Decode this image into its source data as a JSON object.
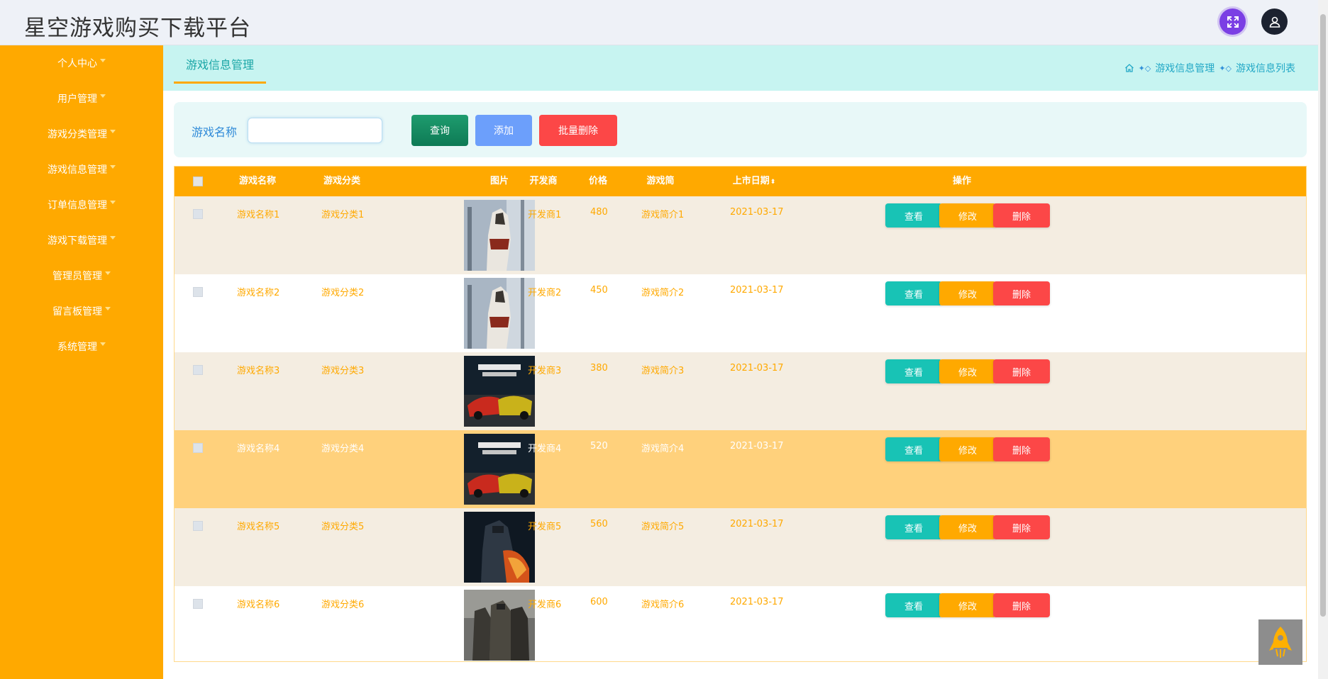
{
  "header": {
    "title": "星空游戏购买下载平台",
    "fullscreen_icon": "expand-icon",
    "user_icon": "user-icon"
  },
  "sidebar": {
    "items": [
      {
        "label": "个人中心"
      },
      {
        "label": "用户管理"
      },
      {
        "label": "游戏分类管理"
      },
      {
        "label": "游戏信息管理"
      },
      {
        "label": "订单信息管理"
      },
      {
        "label": "游戏下载管理"
      },
      {
        "label": "管理员管理"
      },
      {
        "label": "留言板管理"
      },
      {
        "label": "系统管理"
      }
    ]
  },
  "tabs": {
    "active": "游戏信息管理"
  },
  "breadcrumb": {
    "items": [
      "游戏信息管理",
      "游戏信息列表"
    ]
  },
  "search": {
    "label": "游戏名称",
    "value": "",
    "placeholder": "",
    "query_label": "查询",
    "add_label": "添加",
    "batch_delete_label": "批量删除"
  },
  "table": {
    "columns": {
      "name": "游戏名称",
      "category": "游戏分类",
      "image": "图片",
      "developer": "开发商",
      "price": "价格",
      "intro": "游戏简介",
      "release_date": "上市日期",
      "actions": "操作"
    },
    "rows": [
      {
        "name": "游戏名称1",
        "category": "游戏分类1",
        "developer": "开发商1",
        "price": "480",
        "intro": "游戏简介1",
        "release_date": "2021-03-17",
        "image": "hooded-warrior-snow"
      },
      {
        "name": "游戏名称2",
        "category": "游戏分类2",
        "developer": "开发商2",
        "price": "450",
        "intro": "游戏简介2",
        "release_date": "2021-03-17",
        "image": "hooded-warrior-snow"
      },
      {
        "name": "游戏名称3",
        "category": "游戏分类3",
        "developer": "开发商3",
        "price": "380",
        "intro": "游戏简介3",
        "release_date": "2021-03-17",
        "image": "racing-cars-night"
      },
      {
        "name": "游戏名称4",
        "category": "游戏分类4",
        "developer": "开发商4",
        "price": "520",
        "intro": "游戏简介4",
        "release_date": "2021-03-17",
        "image": "racing-cars-night"
      },
      {
        "name": "游戏名称5",
        "category": "游戏分类5",
        "developer": "开发商5",
        "price": "560",
        "intro": "游戏简介5",
        "release_date": "2021-03-17",
        "image": "soldier-fire"
      },
      {
        "name": "游戏名称6",
        "category": "游戏分类6",
        "developer": "开发商6",
        "price": "600",
        "intro": "游戏简介6",
        "release_date": "2021-03-17",
        "image": "squad-soldiers"
      }
    ],
    "action_labels": {
      "view": "查看",
      "edit": "修改",
      "delete": "删除"
    }
  },
  "colors": {
    "accent": "#ffa900",
    "teal": "#18c3b5",
    "danger": "#fc4747",
    "primary_blue": "#6c9ffb",
    "tabbar": "#c7f4f1"
  }
}
